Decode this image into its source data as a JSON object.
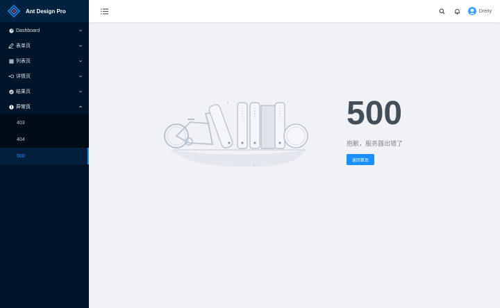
{
  "app": {
    "title": "Ant Design Pro"
  },
  "sidebar": {
    "items": [
      {
        "label": "Dashboard",
        "icon": "dashboard-icon"
      },
      {
        "label": "表单页",
        "icon": "form-icon"
      },
      {
        "label": "列表页",
        "icon": "table-icon"
      },
      {
        "label": "详情页",
        "icon": "profile-icon"
      },
      {
        "label": "结果页",
        "icon": "check-circle-icon"
      },
      {
        "label": "异常页",
        "icon": "warning-icon"
      }
    ],
    "exception_children": [
      {
        "label": "403"
      },
      {
        "label": "404"
      },
      {
        "label": "500"
      }
    ]
  },
  "header": {
    "menu_icon": "menu-fold-icon",
    "search_icon": "search-icon",
    "bell_icon": "bell-icon",
    "user_name": "Dreity"
  },
  "exception": {
    "code": "500",
    "description": "抱歉，服务器出错了",
    "back_button": "返回首页"
  },
  "colors": {
    "primary": "#1890ff",
    "sider": "#001529",
    "submenu": "#000c17",
    "title": "#434e59"
  }
}
